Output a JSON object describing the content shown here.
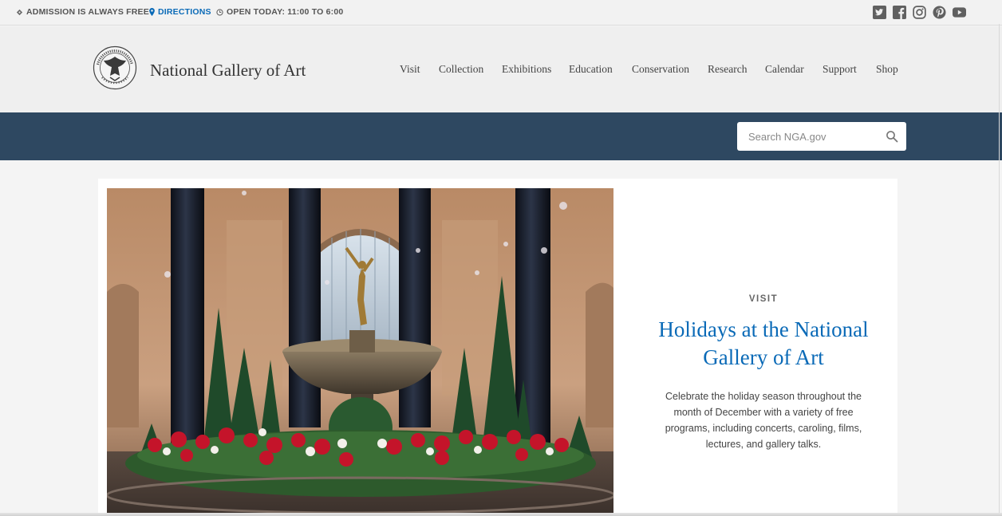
{
  "utility": {
    "admission": "ADMISSION IS ALWAYS FREE",
    "directions": "DIRECTIONS",
    "hours": "OPEN TODAY: 11:00 TO 6:00",
    "social_icons": [
      "twitter-icon",
      "facebook-icon",
      "instagram-icon",
      "pinterest-icon",
      "youtube-icon"
    ]
  },
  "header": {
    "logo_text": "National Gallery of Art",
    "nav": [
      "Visit",
      "Collection",
      "Exhibitions",
      "Education",
      "Conservation",
      "Research",
      "Calendar",
      "Support",
      "Shop"
    ]
  },
  "search": {
    "placeholder": "Search NGA.gov"
  },
  "feature": {
    "eyebrow": "VISIT",
    "headline": "Holidays at the National Gallery of Art",
    "description": "Celebrate the holiday season throughout the month of December with a variety of free programs, including concerts, caroling, films, lectures, and gallery talks."
  },
  "colors": {
    "band": "#2e4861",
    "link": "#0a6ab7",
    "utility_bg": "#f2f2f2"
  }
}
